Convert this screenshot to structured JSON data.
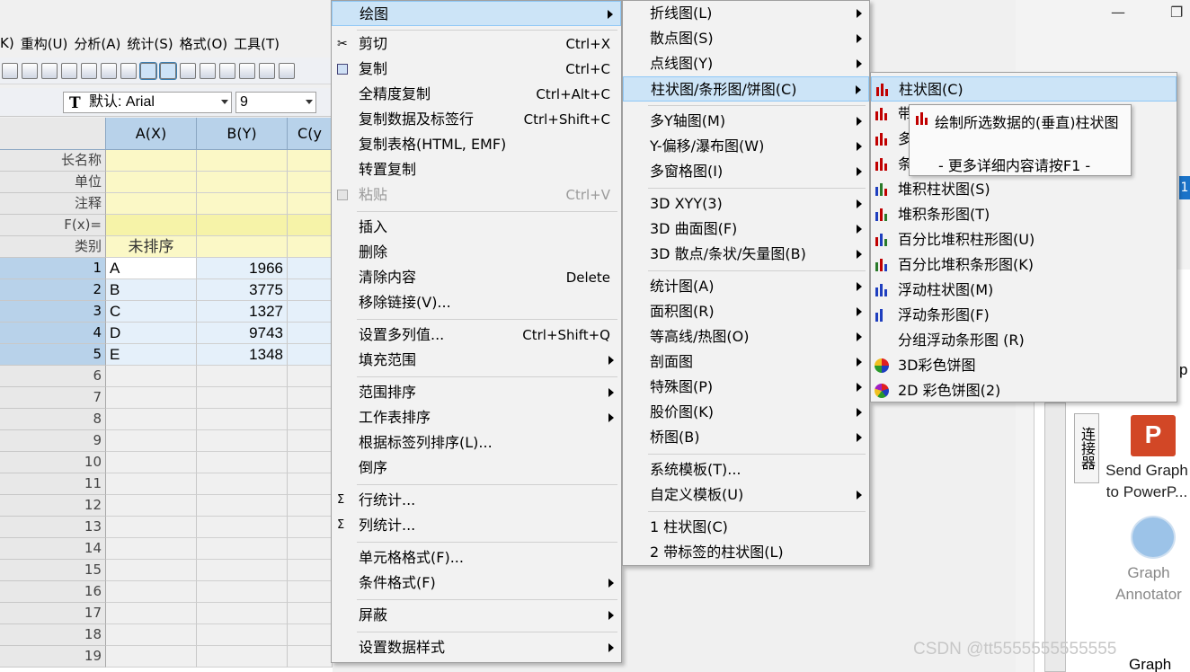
{
  "menubar": [
    "K)",
    "重构(U)",
    "分析(A)",
    "统计(S)",
    "格式(O)",
    "工具(T)"
  ],
  "toolbar": {
    "font_name": "默认: Arial",
    "font_size": "9"
  },
  "sheet": {
    "columns": [
      "A(X)",
      "B(Y)",
      "C(y"
    ],
    "meta_rows": [
      "长名称",
      "单位",
      "注释",
      "F(x)=",
      "类别"
    ],
    "category_value": "未排序",
    "data_rows": [
      {
        "n": "1",
        "a": "A",
        "b": "1966"
      },
      {
        "n": "2",
        "a": "B",
        "b": "3775"
      },
      {
        "n": "3",
        "a": "C",
        "b": "1327"
      },
      {
        "n": "4",
        "a": "D",
        "b": "9743"
      },
      {
        "n": "5",
        "a": "E",
        "b": "1348"
      }
    ],
    "empty_rows": [
      "6",
      "7",
      "8",
      "9",
      "10",
      "11",
      "12",
      "13",
      "14",
      "15",
      "16",
      "17",
      "18",
      "19"
    ]
  },
  "context_menu": {
    "items": [
      {
        "label": "绘图",
        "shortcut": "",
        "submenu": true
      },
      {
        "label": "剪切",
        "shortcut": "Ctrl+X"
      },
      {
        "label": "复制",
        "shortcut": "Ctrl+C"
      },
      {
        "label": "全精度复制",
        "shortcut": "Ctrl+Alt+C"
      },
      {
        "label": "复制数据及标签行",
        "shortcut": "Ctrl+Shift+C"
      },
      {
        "label": "复制表格(HTML, EMF)",
        "shortcut": ""
      },
      {
        "label": "转置复制",
        "shortcut": ""
      },
      {
        "label": "粘贴",
        "shortcut": "Ctrl+V"
      },
      {
        "label": "插入",
        "shortcut": ""
      },
      {
        "label": "删除",
        "shortcut": ""
      },
      {
        "label": "清除内容",
        "shortcut": "Delete"
      },
      {
        "label": "移除链接(V)...",
        "shortcut": ""
      },
      {
        "label": "设置多列值...",
        "shortcut": "Ctrl+Shift+Q"
      },
      {
        "label": "填充范围",
        "shortcut": ""
      },
      {
        "label": "范围排序",
        "shortcut": ""
      },
      {
        "label": "工作表排序",
        "shortcut": ""
      },
      {
        "label": "根据标签列排序(L)...",
        "shortcut": ""
      },
      {
        "label": "倒序",
        "shortcut": ""
      },
      {
        "label": "行统计...",
        "shortcut": ""
      },
      {
        "label": "列统计...",
        "shortcut": ""
      },
      {
        "label": "单元格格式(F)...",
        "shortcut": ""
      },
      {
        "label": "条件格式(F)",
        "shortcut": ""
      },
      {
        "label": "屏蔽",
        "shortcut": ""
      },
      {
        "label": "设置数据样式",
        "shortcut": ""
      }
    ]
  },
  "plot_menu": {
    "items": [
      "折线图(L)",
      "散点图(S)",
      "点线图(Y)",
      "柱状图/条形图/饼图(C)",
      "多Y轴图(M)",
      "Y-偏移/瀑布图(W)",
      "多窗格图(I)",
      "3D XYY(3)",
      "3D 曲面图(F)",
      "3D 散点/条状/矢量图(B)",
      "统计图(A)",
      "面积图(R)",
      "等高线/热图(O)",
      "剖面图",
      "特殊图(P)",
      "股价图(K)",
      "桥图(B)",
      "系统模板(T)...",
      "自定义模板(U)",
      "1 柱状图(C)",
      "2 带标签的柱状图(L)"
    ]
  },
  "bar_menu": {
    "items": [
      "柱状图(C)",
      "带标签的柱状图",
      "多",
      "条",
      "堆积柱状图(S)",
      "堆积条形图(T)",
      "百分比堆积柱形图(U)",
      "百分比堆积条形图(K)",
      "浮动柱状图(M)",
      "浮动条形图(F)",
      "分组浮动条形图 (R)",
      "3D彩色饼图",
      "2D 彩色饼图(2)"
    ]
  },
  "tooltip": {
    "title": "绘制所选数据的(垂直)柱状图",
    "hint": "- 更多详细内容请按F1 -"
  },
  "right_panel": {
    "vertical_tab": "连接器",
    "send_graph": "Send Graph to PowerP...",
    "ppt_glyph": "P",
    "graph_annotator": "Graph Annotator",
    "blue_tab": "1",
    "letter_p": "p",
    "graph_partial": "Graph"
  },
  "watermark": "CSDN @tt5555555555555"
}
